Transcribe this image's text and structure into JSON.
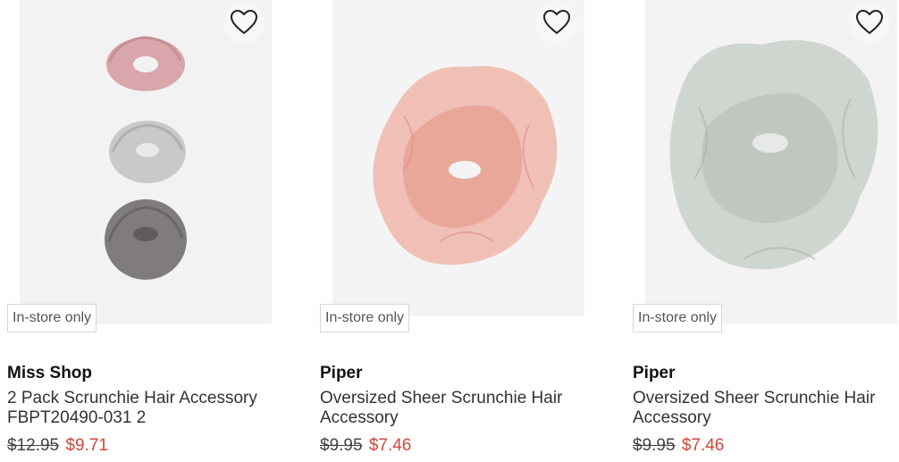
{
  "products": [
    {
      "brand": "Miss Shop",
      "title_line1": "2 Pack Scrunchie Hair Accessory",
      "title_line2": "FBPT20490-031 2",
      "badge": "In-store only",
      "old_price": "$12.95",
      "sale_price": "$9.71",
      "colors": [
        "#d9a6ab",
        "#c4c4c4",
        "#7d7a79"
      ]
    },
    {
      "brand": "Piper",
      "title_line1": "Oversized Sheer Scrunchie Hair",
      "title_line2": "Accessory",
      "badge": "In-store only",
      "old_price": "$9.95",
      "sale_price": "$7.46",
      "colors": [
        "#e9a89a"
      ]
    },
    {
      "brand": "Piper",
      "title_line1": "Oversized Sheer Scrunchie Hair",
      "title_line2": "Accessory",
      "badge": "In-store only",
      "old_price": "$9.95",
      "sale_price": "$7.46",
      "colors": [
        "#c6cdc6"
      ]
    }
  ],
  "icons": {
    "wishlist": "heart-outline-icon"
  },
  "accent": {
    "sale_price": "#d0463a"
  }
}
